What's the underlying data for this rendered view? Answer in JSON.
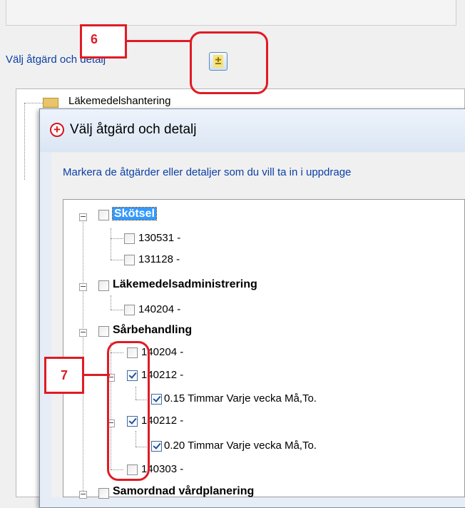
{
  "background_window": {
    "link_label": "Välj åtgärd och detalj",
    "tree_item_label": "Läkemedelshantering",
    "button_glyph": "±"
  },
  "annotations": {
    "callout_6": "6",
    "callout_7": "7"
  },
  "dialog": {
    "add_icon_glyph": "+",
    "title": "Välj åtgärd och detalj",
    "instruction": "Markera de åtgärder eller detaljer som du vill ta in i uppdrage"
  },
  "tree": {
    "expander_glyph": "−",
    "items": [
      {
        "label": "Skötsel",
        "checked": false
      },
      {
        "label": "130531 -",
        "checked": false
      },
      {
        "label": "131128 -",
        "checked": false
      },
      {
        "label": "Läkemedelsadministrering",
        "checked": false
      },
      {
        "label": "140204 -",
        "checked": false
      },
      {
        "label": "Sårbehandling",
        "checked": false
      },
      {
        "label": "140204 -",
        "checked": false
      },
      {
        "label": "140212 -",
        "checked": true
      },
      {
        "label": "0.15 Timmar  Varje vecka Må,To.",
        "checked": true
      },
      {
        "label": "140212 -",
        "checked": true
      },
      {
        "label": "0.20 Timmar  Varje vecka Må,To.",
        "checked": true
      },
      {
        "label": "140303 -",
        "checked": false
      },
      {
        "label": "Samordnad vårdplanering",
        "checked": false
      }
    ]
  },
  "colors": {
    "accent": "#e01b24",
    "link": "#0b3fa4",
    "selection": "#3399ff"
  }
}
